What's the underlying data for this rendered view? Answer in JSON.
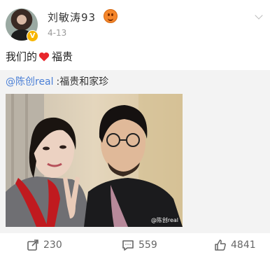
{
  "post": {
    "username": "刘敏涛93",
    "date": "4-13",
    "text_before": "我们的",
    "text_after": "福贵"
  },
  "retweet": {
    "mention": "@陈创real",
    "mention_text": ":福贵和家珍",
    "watermark": "@陈创real"
  },
  "actions": {
    "repost_count": "230",
    "comment_count": "559",
    "like_count": "4841"
  },
  "icons": {
    "badge": "verified-v-icon",
    "level": "smiley-level-icon",
    "heart": "red-heart-icon",
    "repost": "repost-icon",
    "comment": "comment-icon",
    "like": "thumbs-up-icon"
  },
  "colors": {
    "link": "#4a7fd6",
    "heart": "#e8262b",
    "verified": "#f7b500"
  }
}
